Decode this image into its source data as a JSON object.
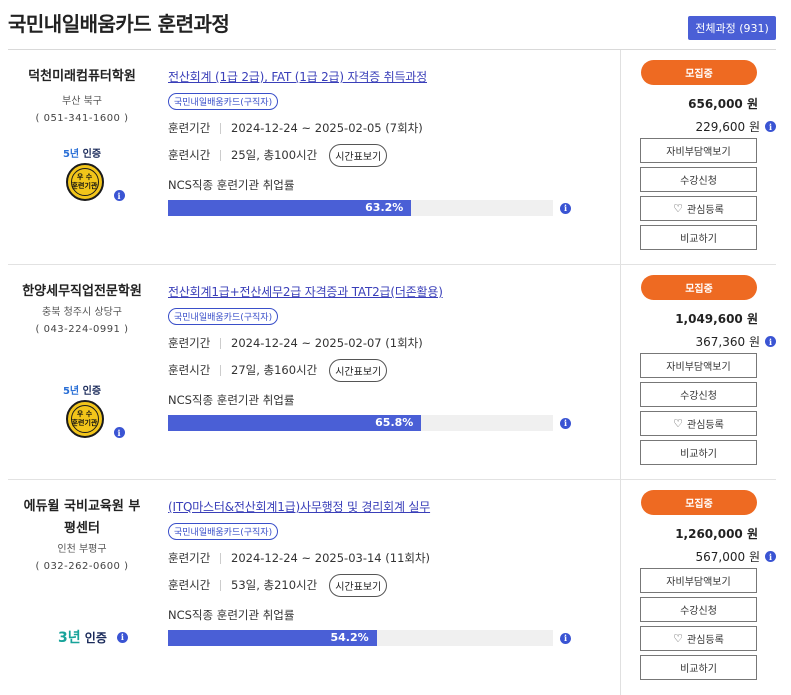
{
  "header": {
    "title": "국민내일배움카드 훈련과정",
    "all_button": "전체과정 (931)"
  },
  "labels": {
    "period": "훈련기간",
    "hours": "훈련시간",
    "timetable": "시간표보기",
    "ncs": "NCS직종 훈련기관 취업률",
    "recruit": "모집중",
    "subsidy": "자비부담액보기",
    "apply": "수강신청",
    "interest": "관심등록",
    "compare": "비교하기",
    "info": "i"
  },
  "rows": [
    {
      "institute": "덕천미래컴퓨터학원",
      "area": "부산 북구",
      "phone": "( 051-341-1600 )",
      "cert_years": "5년",
      "cert_suffix": " 인증",
      "medal_top": "우 수",
      "medal_bottom": "훈련기관",
      "course": "전산회계 (1급 2급), FAT (1급 2급) 자격증 취득과정",
      "tag": "국민내일배움카드(구직자)",
      "period": "2024-12-24 ~ 2025-02-05 (7회차)",
      "hours": "25일, 총100시간",
      "rate_text": "63.2%",
      "rate": 63.2,
      "price": "656,000 원",
      "self_pay": "229,600 원"
    },
    {
      "institute": "한양세무직업전문학원",
      "area": "충북 청주시 상당구",
      "phone": "( 043-224-0991 )",
      "cert_years": "5년",
      "cert_suffix": " 인증",
      "medal_top": "우 수",
      "medal_bottom": "훈련기관",
      "course": "전산회계1급+전산세무2급 자격증과 TAT2급(더존활용)",
      "tag": "국민내일배움카드(구직자)",
      "period": "2024-12-24 ~ 2025-02-07 (1회차)",
      "hours": "27일, 총160시간",
      "rate_text": "65.8%",
      "rate": 65.8,
      "price": "1,049,600 원",
      "self_pay": "367,360 원"
    },
    {
      "institute": "에듀윌 국비교육원 부평센터",
      "area": "인천 부평구",
      "phone": "( 032-262-0600 )",
      "cert_years": "3년",
      "cert_suffix": " 인증",
      "course": "(ITQ마스터&전산회계1급)사무행정 및 경리회계 실무",
      "tag": "국민내일배움카드(구직자)",
      "period": "2024-12-24 ~ 2025-03-14 (11회차)",
      "hours": "53일, 총210시간",
      "rate_text": "54.2%",
      "rate": 54.2,
      "price": "1,260,000 원",
      "self_pay": "567,000 원"
    }
  ]
}
